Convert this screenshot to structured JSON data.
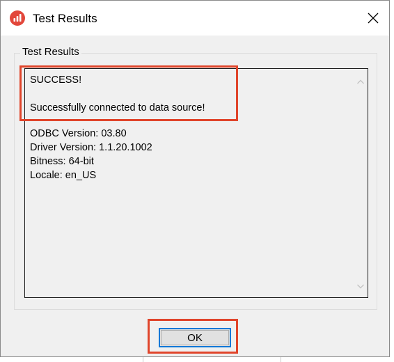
{
  "window": {
    "title": "Test Results",
    "app_icon": "bar-chart-icon",
    "close_icon": "close-icon"
  },
  "group": {
    "label": "Test Results"
  },
  "results": {
    "status": "SUCCESS!",
    "message": "Successfully connected to data source!",
    "details": [
      "ODBC Version: 03.80",
      "Driver Version: 1.1.20.1002",
      "Bitness: 64-bit",
      "Locale: en_US"
    ]
  },
  "buttons": {
    "ok_label": "OK"
  },
  "colors": {
    "highlight": "#e0452b",
    "app_icon": "#e2473b",
    "ok_border": "#0078d7"
  }
}
